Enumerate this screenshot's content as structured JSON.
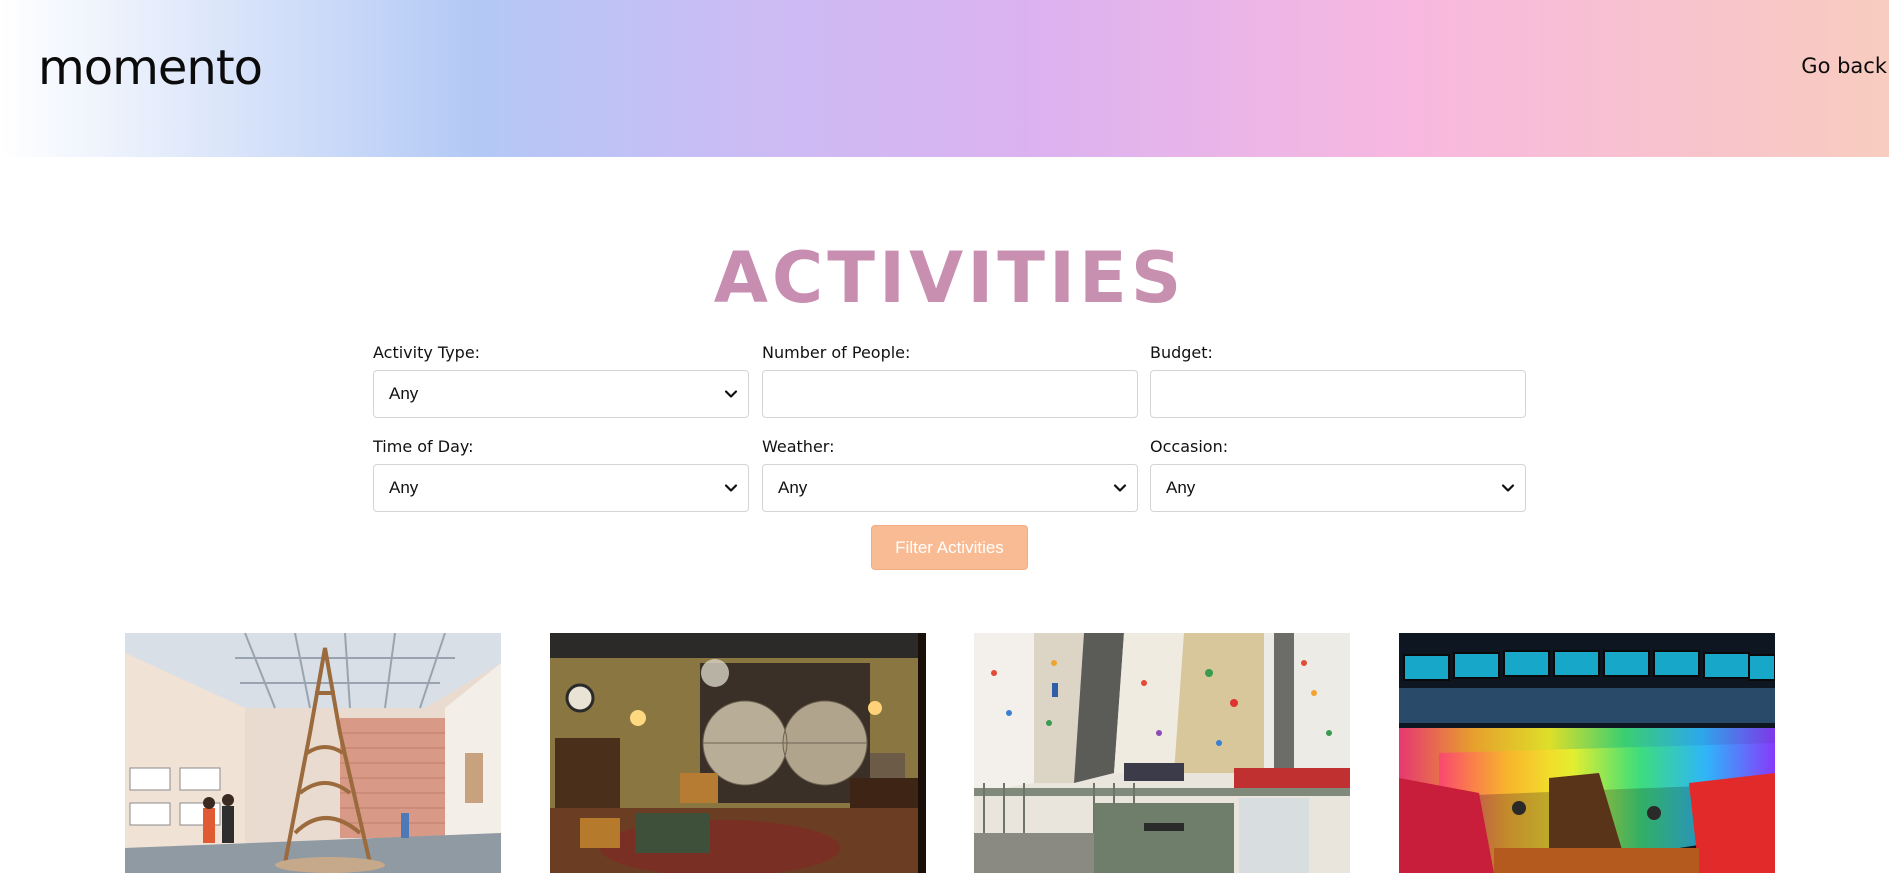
{
  "header": {
    "logo": "momento",
    "go_back_label": "Go back"
  },
  "page_title": "ACTIVITIES",
  "filters": {
    "activity_type": {
      "label": "Activity Type:",
      "value": "Any"
    },
    "number_of_people": {
      "label": "Number of People:",
      "value": ""
    },
    "budget": {
      "label": "Budget:",
      "value": ""
    },
    "time_of_day": {
      "label": "Time of Day:",
      "value": "Any"
    },
    "weather": {
      "label": "Weather:",
      "value": "Any"
    },
    "occasion": {
      "label": "Occasion:",
      "value": "Any"
    },
    "submit_label": "Filter Activities"
  },
  "colors": {
    "title": "#c48eb1",
    "filter_button": "#f8bb93",
    "header_gradient": [
      "#ffffff",
      "#b3c9f5",
      "#dcb2f0",
      "#f8b8df",
      "#f8ccbf"
    ]
  },
  "activities": [
    {
      "image": "museum-gallery-tower-sculpture"
    },
    {
      "image": "escape-room-antique-map-interior"
    },
    {
      "image": "indoor-climbing-gym"
    },
    {
      "image": "neon-bowling-alley"
    }
  ]
}
